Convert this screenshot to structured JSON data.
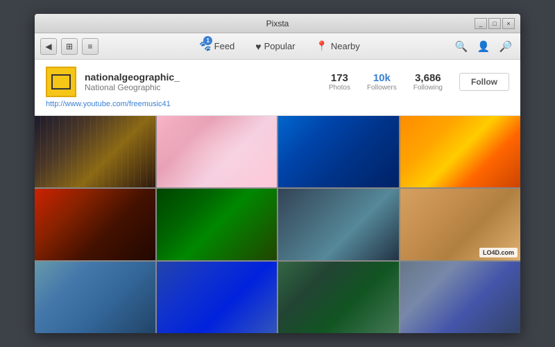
{
  "window": {
    "title": "Pixsta",
    "controls": [
      "_",
      "□",
      "×"
    ]
  },
  "toolbar": {
    "back_label": "◀",
    "grid_label": "⊞",
    "menu_label": "≡",
    "feed_label": "Feed",
    "feed_badge": "1",
    "popular_label": "Popular",
    "nearby_label": "Nearby",
    "search_label": "🔍",
    "user_label": "👤",
    "search2_label": "🔍"
  },
  "profile": {
    "username": "nationalgeographic_",
    "realname": "National Geographic",
    "link": "http://www.youtube.com/freemusic41",
    "stats": {
      "photos_value": "173",
      "photos_label": "Photos",
      "followers_value": "10k",
      "followers_label": "Followers",
      "following_value": "3,686",
      "following_label": "Following"
    },
    "follow_button": "Follow"
  },
  "photos": [
    {
      "id": 1,
      "cls": "photo-1"
    },
    {
      "id": 2,
      "cls": "photo-2"
    },
    {
      "id": 3,
      "cls": "photo-3"
    },
    {
      "id": 4,
      "cls": "photo-4"
    },
    {
      "id": 5,
      "cls": "photo-5"
    },
    {
      "id": 6,
      "cls": "photo-6"
    },
    {
      "id": 7,
      "cls": "photo-7"
    },
    {
      "id": 8,
      "cls": "photo-8"
    },
    {
      "id": 9,
      "cls": "photo-9"
    },
    {
      "id": 10,
      "cls": "photo-10"
    },
    {
      "id": 11,
      "cls": "photo-11"
    },
    {
      "id": 12,
      "cls": "photo-12"
    }
  ],
  "watermark": "LO4D.com"
}
